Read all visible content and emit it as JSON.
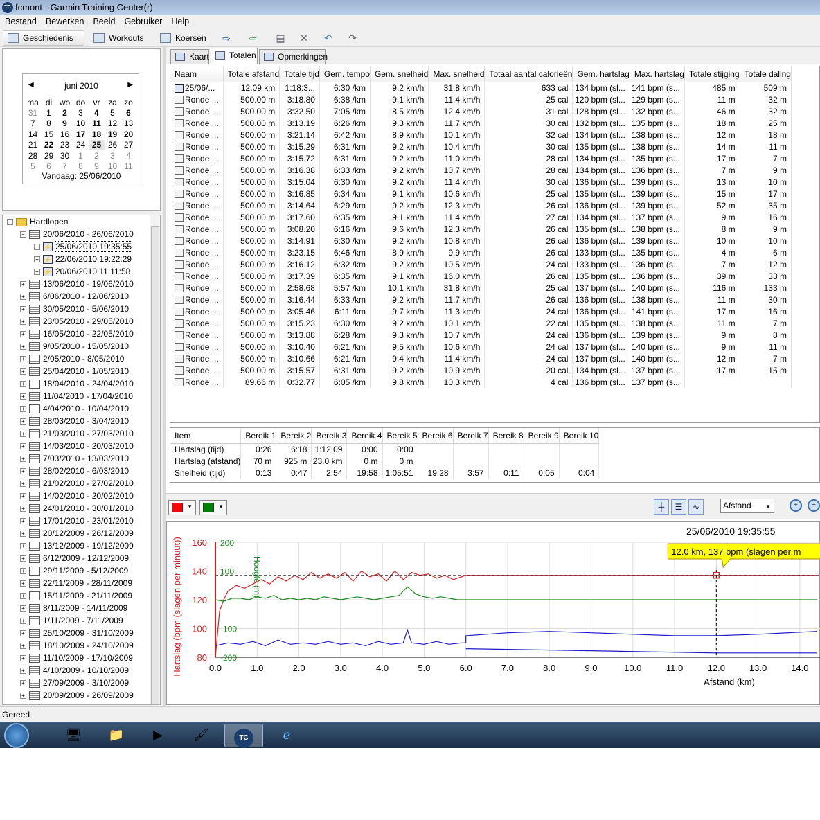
{
  "window": {
    "title": "fcmont - Garmin Training Center(r)",
    "icon_text": "TC"
  },
  "menu": [
    "Bestand",
    "Bewerken",
    "Beeld",
    "Gebruiker",
    "Help"
  ],
  "toolbar": {
    "history": "Geschiedenis",
    "workouts": "Workouts",
    "courses": "Koersen"
  },
  "calendar": {
    "month": "juni 2010",
    "weekdays": [
      "ma",
      "di",
      "wo",
      "do",
      "vr",
      "za",
      "zo"
    ],
    "weeks": [
      [
        "31",
        "1",
        "2",
        "3",
        "4",
        "5",
        "6"
      ],
      [
        "7",
        "8",
        "9",
        "10",
        "11",
        "12",
        "13"
      ],
      [
        "14",
        "15",
        "16",
        "17",
        "18",
        "19",
        "20"
      ],
      [
        "21",
        "22",
        "23",
        "24",
        "25",
        "26",
        "27"
      ],
      [
        "28",
        "29",
        "30",
        "1",
        "2",
        "3",
        "4"
      ],
      [
        "5",
        "6",
        "7",
        "8",
        "9",
        "10",
        "11"
      ]
    ],
    "today_label": "Vandaag: 25/06/2010"
  },
  "tree": {
    "root": "Hardlopen",
    "current_week": "20/06/2010 - 26/06/2010",
    "activities": [
      "25/06/2010 19:35:55",
      "22/06/2010 19:22:29",
      "20/06/2010 11:11:58"
    ],
    "weeks": [
      "13/06/2010 - 19/06/2010",
      "6/06/2010 - 12/06/2010",
      "30/05/2010 - 5/06/2010",
      "23/05/2010 - 29/05/2010",
      "16/05/2010 - 22/05/2010",
      "9/05/2010 - 15/05/2010",
      "2/05/2010 - 8/05/2010",
      "25/04/2010 - 1/05/2010",
      "18/04/2010 - 24/04/2010",
      "11/04/2010 - 17/04/2010",
      "4/04/2010 - 10/04/2010",
      "28/03/2010 - 3/04/2010",
      "21/03/2010 - 27/03/2010",
      "14/03/2010 - 20/03/2010",
      "7/03/2010 - 13/03/2010",
      "28/02/2010 - 6/03/2010",
      "21/02/2010 - 27/02/2010",
      "14/02/2010 - 20/02/2010",
      "24/01/2010 - 30/01/2010",
      "17/01/2010 - 23/01/2010",
      "20/12/2009 - 26/12/2009",
      "13/12/2009 - 19/12/2009",
      "6/12/2009 - 12/12/2009",
      "29/11/2009 - 5/12/2009",
      "22/11/2009 - 28/11/2009",
      "15/11/2009 - 21/11/2009",
      "8/11/2009 - 14/11/2009",
      "1/11/2009 - 7/11/2009",
      "25/10/2009 - 31/10/2009",
      "18/10/2009 - 24/10/2009",
      "11/10/2009 - 17/10/2009",
      "4/10/2009 - 10/10/2009",
      "27/09/2009 - 3/10/2009",
      "20/09/2009 - 26/09/2009",
      "13/09/2009 - 19/09/2009"
    ]
  },
  "tabs": [
    "Kaart",
    "Totalen",
    "Opmerkingen"
  ],
  "laps": {
    "columns": [
      "Naam",
      "Totale afstand",
      "Totale tijd",
      "Gem. tempo",
      "Gem. snelheid",
      "Max. snelheid",
      "Totaal aantal calorieën",
      "Gem. hartslag",
      "Max. hartslag",
      "Totale stijging",
      "Totale daling"
    ],
    "rows": [
      [
        "25/06/...",
        "12.09 km",
        "1:18:3...",
        "6:30 /km",
        "9.2 km/h",
        "31.8 km/h",
        "633 cal",
        "134 bpm (sl...",
        "141 bpm (s...",
        "485 m",
        "509 m"
      ],
      [
        "Ronde ...",
        "500.00 m",
        "3:18.80",
        "6:38 /km",
        "9.1 km/h",
        "11.4 km/h",
        "25 cal",
        "120 bpm (sl...",
        "129 bpm (s...",
        "11 m",
        "32 m"
      ],
      [
        "Ronde ...",
        "500.00 m",
        "3:32.50",
        "7:05 /km",
        "8.5 km/h",
        "12.4 km/h",
        "31 cal",
        "128 bpm (sl...",
        "132 bpm (s...",
        "46 m",
        "32 m"
      ],
      [
        "Ronde ...",
        "500.00 m",
        "3:13.19",
        "6:26 /km",
        "9.3 km/h",
        "11.7 km/h",
        "30 cal",
        "132 bpm (sl...",
        "135 bpm (s...",
        "18 m",
        "25 m"
      ],
      [
        "Ronde ...",
        "500.00 m",
        "3:21.14",
        "6:42 /km",
        "8.9 km/h",
        "10.1 km/h",
        "32 cal",
        "134 bpm (sl...",
        "138 bpm (s...",
        "12 m",
        "18 m"
      ],
      [
        "Ronde ...",
        "500.00 m",
        "3:15.29",
        "6:31 /km",
        "9.2 km/h",
        "10.4 km/h",
        "30 cal",
        "135 bpm (sl...",
        "138 bpm (s...",
        "14 m",
        "11 m"
      ],
      [
        "Ronde ...",
        "500.00 m",
        "3:15.72",
        "6:31 /km",
        "9.2 km/h",
        "11.0 km/h",
        "28 cal",
        "134 bpm (sl...",
        "135 bpm (s...",
        "17 m",
        "7 m"
      ],
      [
        "Ronde ...",
        "500.00 m",
        "3:16.38",
        "6:33 /km",
        "9.2 km/h",
        "10.7 km/h",
        "28 cal",
        "134 bpm (sl...",
        "136 bpm (s...",
        "7 m",
        "9 m"
      ],
      [
        "Ronde ...",
        "500.00 m",
        "3:15.04",
        "6:30 /km",
        "9.2 km/h",
        "11.4 km/h",
        "30 cal",
        "136 bpm (sl...",
        "139 bpm (s...",
        "13 m",
        "10 m"
      ],
      [
        "Ronde ...",
        "500.00 m",
        "3:16.85",
        "6:34 /km",
        "9.1 km/h",
        "10.6 km/h",
        "25 cal",
        "135 bpm (sl...",
        "139 bpm (s...",
        "15 m",
        "17 m"
      ],
      [
        "Ronde ...",
        "500.00 m",
        "3:14.64",
        "6:29 /km",
        "9.2 km/h",
        "12.3 km/h",
        "26 cal",
        "136 bpm (sl...",
        "139 bpm (s...",
        "52 m",
        "35 m"
      ],
      [
        "Ronde ...",
        "500.00 m",
        "3:17.60",
        "6:35 /km",
        "9.1 km/h",
        "11.4 km/h",
        "27 cal",
        "134 bpm (sl...",
        "137 bpm (s...",
        "9 m",
        "16 m"
      ],
      [
        "Ronde ...",
        "500.00 m",
        "3:08.20",
        "6:16 /km",
        "9.6 km/h",
        "12.3 km/h",
        "26 cal",
        "135 bpm (sl...",
        "138 bpm (s...",
        "8 m",
        "9 m"
      ],
      [
        "Ronde ...",
        "500.00 m",
        "3:14.91",
        "6:30 /km",
        "9.2 km/h",
        "10.8 km/h",
        "26 cal",
        "136 bpm (sl...",
        "139 bpm (s...",
        "10 m",
        "10 m"
      ],
      [
        "Ronde ...",
        "500.00 m",
        "3:23.15",
        "6:46 /km",
        "8.9 km/h",
        "9.9 km/h",
        "26 cal",
        "133 bpm (sl...",
        "135 bpm (s...",
        "4 m",
        "6 m"
      ],
      [
        "Ronde ...",
        "500.00 m",
        "3:16.12",
        "6:32 /km",
        "9.2 km/h",
        "10.5 km/h",
        "24 cal",
        "133 bpm (sl...",
        "136 bpm (s...",
        "7 m",
        "12 m"
      ],
      [
        "Ronde ...",
        "500.00 m",
        "3:17.39",
        "6:35 /km",
        "9.1 km/h",
        "16.0 km/h",
        "26 cal",
        "135 bpm (sl...",
        "136 bpm (s...",
        "39 m",
        "33 m"
      ],
      [
        "Ronde ...",
        "500.00 m",
        "2:58.68",
        "5:57 /km",
        "10.1 km/h",
        "31.8 km/h",
        "25 cal",
        "137 bpm (sl...",
        "140 bpm (s...",
        "116 m",
        "133 m"
      ],
      [
        "Ronde ...",
        "500.00 m",
        "3:16.44",
        "6:33 /km",
        "9.2 km/h",
        "11.7 km/h",
        "26 cal",
        "136 bpm (sl...",
        "138 bpm (s...",
        "11 m",
        "30 m"
      ],
      [
        "Ronde ...",
        "500.00 m",
        "3:05.46",
        "6:11 /km",
        "9.7 km/h",
        "11.3 km/h",
        "24 cal",
        "136 bpm (sl...",
        "141 bpm (s...",
        "17 m",
        "16 m"
      ],
      [
        "Ronde ...",
        "500.00 m",
        "3:15.23",
        "6:30 /km",
        "9.2 km/h",
        "10.1 km/h",
        "22 cal",
        "135 bpm (sl...",
        "138 bpm (s...",
        "11 m",
        "7 m"
      ],
      [
        "Ronde ...",
        "500.00 m",
        "3:13.88",
        "6:28 /km",
        "9.3 km/h",
        "10.7 km/h",
        "24 cal",
        "136 bpm (sl...",
        "139 bpm (s...",
        "9 m",
        "8 m"
      ],
      [
        "Ronde ...",
        "500.00 m",
        "3:10.40",
        "6:21 /km",
        "9.5 km/h",
        "10.6 km/h",
        "24 cal",
        "137 bpm (sl...",
        "140 bpm (s...",
        "9 m",
        "11 m"
      ],
      [
        "Ronde ...",
        "500.00 m",
        "3:10.66",
        "6:21 /km",
        "9.4 km/h",
        "11.4 km/h",
        "24 cal",
        "137 bpm (sl...",
        "140 bpm (s...",
        "12 m",
        "7 m"
      ],
      [
        "Ronde ...",
        "500.00 m",
        "3:15.57",
        "6:31 /km",
        "9.2 km/h",
        "10.9 km/h",
        "20 cal",
        "134 bpm (sl...",
        "137 bpm (s...",
        "17 m",
        "15 m"
      ],
      [
        "Ronde ...",
        "89.66 m",
        "0:32.77",
        "6:05 /km",
        "9.8 km/h",
        "10.3 km/h",
        "4 cal",
        "136 bpm (sl...",
        "137 bpm (s...",
        "",
        ""
      ]
    ]
  },
  "zones": {
    "columns": [
      "Item",
      "Bereik 1",
      "Bereik 2",
      "Bereik 3",
      "Bereik 4",
      "Bereik 5",
      "Bereik 6",
      "Bereik 7",
      "Bereik 8",
      "Bereik 9",
      "Bereik 10"
    ],
    "rows": [
      [
        "Hartslag (tijd)",
        "0:26",
        "6:18",
        "1:12:09",
        "0:00",
        "0:00",
        "",
        "",
        "",
        "",
        ""
      ],
      [
        "Hartslag (afstand)",
        "70 m",
        "925 m",
        "23.0 km",
        "0 m",
        "0 m",
        "",
        "",
        "",
        "",
        ""
      ],
      [
        "Snelheid (tijd)",
        "0:13",
        "0:47",
        "2:54",
        "19:58",
        "1:05:51",
        "19:28",
        "3:57",
        "0:11",
        "0:05",
        "0:04"
      ]
    ]
  },
  "chart_toolbar": {
    "series1_color": "#ff0000",
    "series2_color": "#008000",
    "xaxis_mode": "Afstand"
  },
  "chart_data": {
    "type": "line",
    "title": "25/06/2010 19:35:55",
    "xlabel": "Afstand (km)",
    "ylabel": "Hartslag (bpm (slagen per minuut))",
    "y2label": "Hoogte (m)",
    "xlim": [
      0,
      14.5
    ],
    "ylim": [
      80,
      160
    ],
    "x_ticks": [
      "0.0",
      "1.0",
      "2.0",
      "3.0",
      "4.0",
      "5.0",
      "6.0",
      "7.0",
      "8.0",
      "9.0",
      "10.0",
      "11.0",
      "12.0",
      "13.0",
      "14.0"
    ],
    "y_ticks": [
      "80",
      "100",
      "120",
      "140",
      "160"
    ],
    "y2_ticks": [
      "-200",
      "-100",
      "100",
      "200"
    ],
    "tooltip": "12.0 km, 137 bpm (slagen per m",
    "cursor_x": 12.0,
    "series": [
      {
        "name": "Hartslag",
        "color": "#d62020",
        "x": [
          0,
          0.1,
          0.2,
          0.3,
          0.5,
          0.7,
          0.9,
          1.1,
          1.3,
          1.5,
          1.7,
          1.9,
          2.1,
          2.3,
          2.5,
          2.7,
          2.9,
          3.1,
          3.3,
          3.5,
          3.7,
          3.9,
          4.1,
          4.3,
          4.5,
          4.7,
          4.9,
          5.1,
          5.3,
          5.5,
          5.7,
          5.9,
          6.0,
          7,
          8,
          9,
          10,
          11,
          12,
          13,
          14.4
        ],
        "y": [
          80,
          112,
          120,
          126,
          130,
          128,
          131,
          134,
          131,
          136,
          133,
          137,
          134,
          139,
          135,
          138,
          135,
          139,
          133,
          140,
          136,
          138,
          133,
          140,
          134,
          139,
          137,
          138,
          135,
          137,
          134,
          136,
          137,
          137,
          137,
          137,
          137,
          137,
          137,
          137,
          137
        ]
      },
      {
        "name": "",
        "color": "#1a8a1a",
        "x": [
          0,
          0.2,
          0.4,
          0.6,
          0.8,
          1.0,
          1.2,
          1.4,
          1.6,
          1.8,
          2.0,
          2.2,
          2.4,
          2.6,
          2.8,
          3.0,
          3.2,
          3.4,
          3.6,
          3.8,
          4.0,
          4.2,
          4.4,
          4.6,
          4.8,
          5.0,
          5.2,
          5.4,
          5.6,
          5.8,
          6.0,
          8,
          10,
          12,
          13,
          14.4
        ],
        "y": [
          120,
          119,
          121,
          121,
          120,
          122,
          121,
          123,
          120,
          121,
          120,
          121,
          120,
          122,
          121,
          120,
          121,
          122,
          121,
          120,
          121,
          122,
          123,
          129,
          124,
          122,
          121,
          122,
          121,
          120,
          120,
          120,
          120,
          120,
          120,
          120
        ]
      },
      {
        "name": "",
        "color": "#1c1cc4",
        "x": [
          0,
          0.3,
          0.6,
          0.9,
          1.2,
          1.5,
          1.8,
          2.1,
          2.4,
          2.7,
          3.0,
          3.3,
          3.6,
          3.9,
          4.2,
          4.5,
          4.6,
          4.7,
          5.0,
          5.3,
          5.6,
          5.9,
          6.0,
          6.0,
          7,
          8,
          9,
          10,
          11,
          12,
          13,
          14.4
        ],
        "y": [
          88,
          90,
          89,
          91,
          88,
          92,
          89,
          90,
          89,
          91,
          89,
          90,
          88,
          91,
          89,
          90,
          99,
          90,
          89,
          91,
          89,
          90,
          90,
          95,
          97,
          98,
          97,
          96,
          95,
          95,
          96,
          98
        ]
      },
      {
        "name": "",
        "color": "#1c1cc4",
        "x": [
          6.0,
          8,
          10,
          12,
          14.4
        ],
        "y": [
          86,
          85,
          84,
          83,
          83
        ]
      }
    ]
  },
  "status": "Gereed"
}
